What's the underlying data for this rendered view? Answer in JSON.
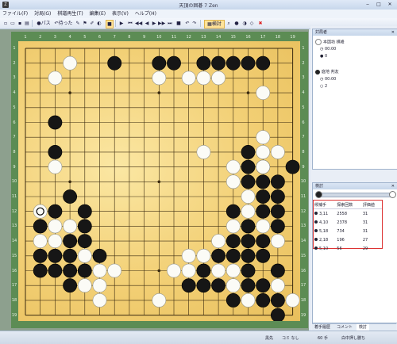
{
  "window": {
    "title": "天頂の囲碁 7 Zen",
    "minimize": "‒",
    "maximize": "□",
    "close": "✕"
  },
  "menu": [
    "ファイル(F)",
    "対局(G)",
    "棋譜再生(T)",
    "編集(E)",
    "表示(V)",
    "ヘルプ(H)"
  ],
  "toolbar": {
    "pass_label": "パス",
    "undo_label": "待った",
    "analysis_label": "検討"
  },
  "board": {
    "size": 19,
    "col_labels": [
      "1",
      "2",
      "3",
      "4",
      "5",
      "6",
      "7",
      "8",
      "9",
      "10",
      "11",
      "12",
      "13",
      "14",
      "15",
      "16",
      "17",
      "18",
      "19"
    ],
    "row_labels": [
      "1",
      "2",
      "3",
      "4",
      "5",
      "6",
      "7",
      "8",
      "9",
      "10",
      "11",
      "12",
      "13",
      "14",
      "15",
      "16",
      "17",
      "18",
      "19"
    ],
    "black_stones": [
      [
        7,
        2
      ],
      [
        10,
        2
      ],
      [
        11,
        2
      ],
      [
        13,
        2
      ],
      [
        14,
        2
      ],
      [
        15,
        2
      ],
      [
        16,
        2
      ],
      [
        17,
        2
      ],
      [
        3,
        6
      ],
      [
        3,
        8
      ],
      [
        4,
        11
      ],
      [
        3,
        12
      ],
      [
        5,
        12
      ],
      [
        2,
        13
      ],
      [
        5,
        13
      ],
      [
        4,
        14
      ],
      [
        5,
        14
      ],
      [
        2,
        15
      ],
      [
        3,
        15
      ],
      [
        4,
        15
      ],
      [
        6,
        15
      ],
      [
        2,
        16
      ],
      [
        3,
        16
      ],
      [
        4,
        16
      ],
      [
        5,
        16
      ],
      [
        13,
        16
      ],
      [
        4,
        17
      ],
      [
        13,
        17
      ],
      [
        14,
        17
      ],
      [
        16,
        17
      ],
      [
        17,
        17
      ],
      [
        15,
        18
      ],
      [
        17,
        18
      ],
      [
        18,
        18
      ],
      [
        18,
        19
      ],
      [
        16,
        8
      ],
      [
        16,
        9
      ],
      [
        17,
        9
      ],
      [
        16,
        10
      ],
      [
        17,
        10
      ],
      [
        18,
        10
      ],
      [
        17,
        11
      ],
      [
        18,
        11
      ],
      [
        17,
        12
      ],
      [
        18,
        12
      ],
      [
        15,
        14
      ],
      [
        16,
        14
      ],
      [
        17,
        14
      ],
      [
        14,
        15
      ],
      [
        15,
        15
      ],
      [
        16,
        15
      ],
      [
        17,
        15
      ],
      [
        16,
        16
      ],
      [
        18,
        16
      ],
      [
        19,
        9
      ],
      [
        18,
        13
      ],
      [
        16,
        13
      ],
      [
        15,
        12
      ],
      [
        12,
        17
      ]
    ],
    "white_stones": [
      [
        4,
        2
      ],
      [
        10,
        3
      ],
      [
        12,
        3
      ],
      [
        13,
        3
      ],
      [
        14,
        3
      ],
      [
        3,
        3
      ],
      [
        17,
        4
      ],
      [
        13,
        8
      ],
      [
        17,
        7
      ],
      [
        17,
        8
      ],
      [
        18,
        8
      ],
      [
        17,
        9
      ],
      [
        15,
        9
      ],
      [
        15,
        10
      ],
      [
        3,
        9
      ],
      [
        2,
        12
      ],
      [
        3,
        13
      ],
      [
        2,
        14
      ],
      [
        3,
        14
      ],
      [
        4,
        13
      ],
      [
        5,
        15
      ],
      [
        6,
        16
      ],
      [
        7,
        16
      ],
      [
        5,
        17
      ],
      [
        6,
        17
      ],
      [
        6,
        18
      ],
      [
        10,
        18
      ],
      [
        12,
        16
      ],
      [
        13,
        15
      ],
      [
        14,
        14
      ],
      [
        14,
        16
      ],
      [
        15,
        13
      ],
      [
        16,
        11
      ],
      [
        16,
        12
      ],
      [
        15,
        16
      ],
      [
        15,
        17
      ],
      [
        16,
        18
      ],
      [
        18,
        17
      ],
      [
        19,
        18
      ],
      [
        17,
        13
      ],
      [
        12,
        15
      ],
      [
        11,
        16
      ],
      [
        18,
        14
      ]
    ],
    "last_move": [
      2,
      12
    ]
  },
  "players": {
    "pane_title": "対局者",
    "white": {
      "name": "本因坊 棋峰",
      "time": "00:00",
      "captures": "0"
    },
    "black": {
      "name": "庭地 判友",
      "time": "00:00",
      "captures": "2"
    }
  },
  "analysis": {
    "pane_title": "検討",
    "columns": [
      "候補手",
      "探索回数",
      "評価値"
    ],
    "rows": [
      [
        "3,11",
        "2558",
        "31"
      ],
      [
        "4,10",
        "2378",
        "31"
      ],
      [
        "5,18",
        "734",
        "31"
      ],
      [
        "2,18",
        "196",
        "27"
      ],
      [
        "5,10",
        "56",
        "29"
      ]
    ]
  },
  "tabs": [
    "着手履歴",
    "コメント",
    "検討"
  ],
  "status": {
    "turn": "黒先",
    "komi": "コミ なし",
    "moves": "60 手",
    "rule": "白中押し勝ち"
  }
}
